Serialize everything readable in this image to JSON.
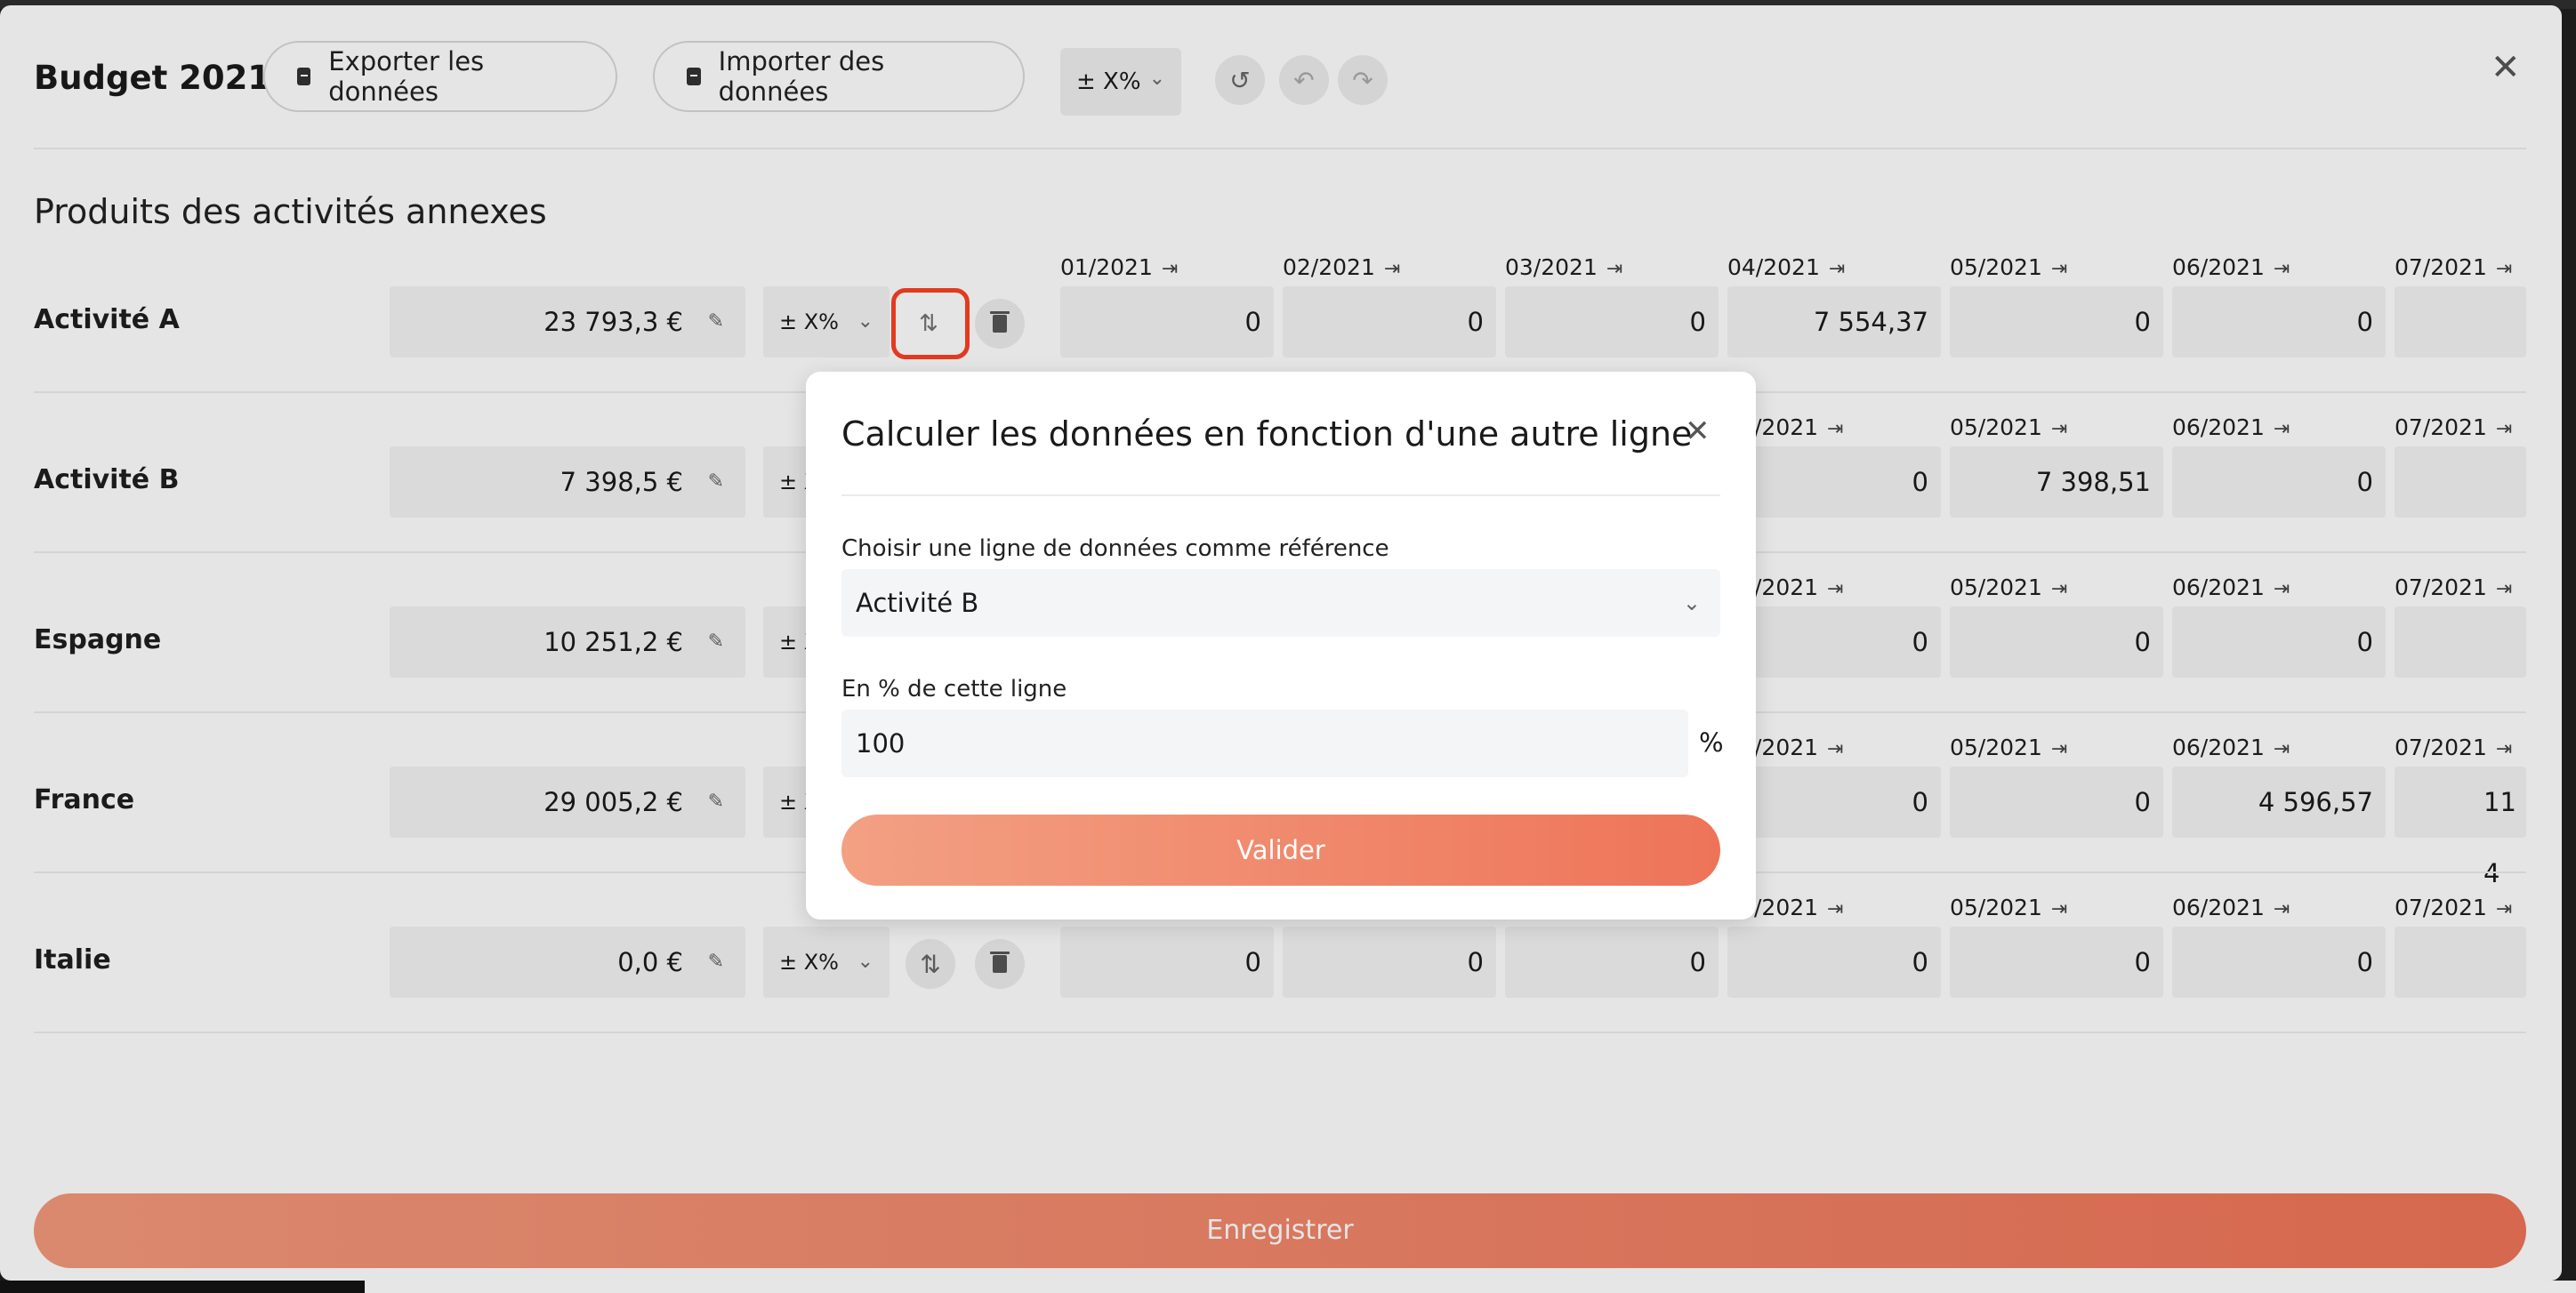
{
  "header": {
    "title": "Budget 2021",
    "export_label": "Exporter les données",
    "import_label": "Importer des données",
    "pct_label": "± X%"
  },
  "section": {
    "title": "Produits des activités annexes"
  },
  "rows": [
    {
      "label": "Activité A",
      "total": "23 793,3 €",
      "pct": "± X%",
      "months": [
        "01/2021",
        "02/2021",
        "03/2021",
        "04/2021",
        "05/2021",
        "06/2021",
        "07/2021"
      ],
      "values": [
        "0",
        "0",
        "0",
        "7 554,37",
        "0",
        "0",
        ""
      ]
    },
    {
      "label": "Activité B",
      "total": "7 398,5 €",
      "pct": "± X%",
      "months": [
        "/2021",
        "05/2021",
        "06/2021",
        "07/2021"
      ],
      "values": [
        "0",
        "7 398,51",
        "0",
        ""
      ]
    },
    {
      "label": "Espagne",
      "total": "10 251,2 €",
      "pct": "± X%",
      "months": [
        "/2021",
        "05/2021",
        "06/2021",
        "07/2021"
      ],
      "values": [
        "0",
        "0",
        "0",
        ""
      ]
    },
    {
      "label": "France",
      "total": "29 005,2 €",
      "pct": "± X%",
      "months": [
        "/2021",
        "05/2021",
        "06/2021",
        "07/2021"
      ],
      "values": [
        "0",
        "0",
        "4 596,57",
        "11 4"
      ]
    },
    {
      "label": "Italie",
      "total": "0,0 €",
      "pct": "± X%",
      "months": [
        "/2021",
        "05/2021",
        "06/2021",
        "07/2021"
      ],
      "values": [
        "0",
        "0",
        "0",
        "0",
        "0",
        "0",
        ""
      ]
    }
  ],
  "save_label": "Enregistrer",
  "dialog": {
    "title": "Calculer les données en fonction d'une autre ligne",
    "ref_label": "Choisir une ligne de données comme référence",
    "ref_value": "Activité B",
    "pct_label": "En % de cette ligne",
    "pct_value": "100",
    "pct_suffix": "%",
    "validate_label": "Valider"
  }
}
